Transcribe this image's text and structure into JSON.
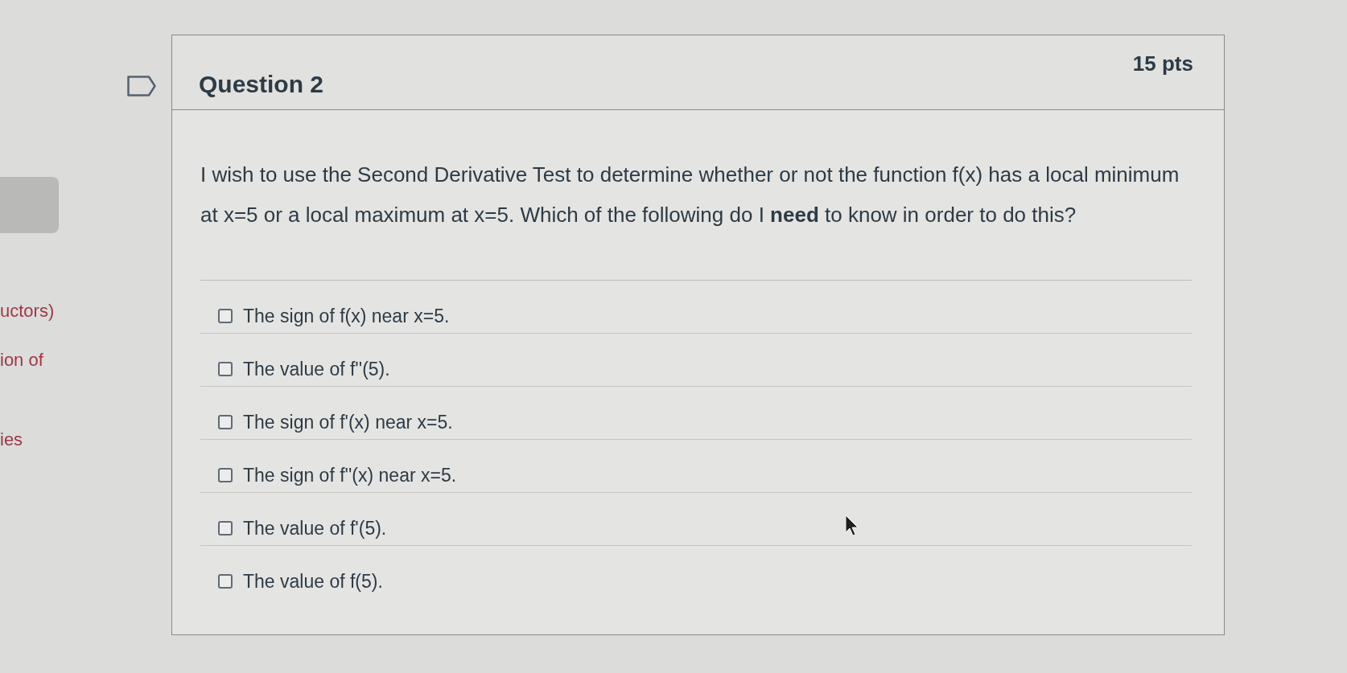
{
  "sidebar": {
    "fragments": [
      "uctors)",
      "ion of",
      "ies"
    ]
  },
  "question": {
    "flagged": false,
    "title": "Question 2",
    "points": "15 pts",
    "text": "I wish to use the Second Derivative Test to determine whether or not the function f(x) has a local minimum at x=5 or a local maximum at x=5.  Which of the following do I **need** to know in order to do this?",
    "options": [
      {
        "label": "The sign of f(x) near x=5.",
        "checked": false
      },
      {
        "label": "The value of f''(5).",
        "checked": false
      },
      {
        "label": "The sign of f'(x) near x=5.",
        "checked": false
      },
      {
        "label": "The sign of f''(x) near x=5.",
        "checked": false
      },
      {
        "label": "The value of f'(5).",
        "checked": false
      },
      {
        "label": "The value of f(5).",
        "checked": false
      }
    ]
  }
}
